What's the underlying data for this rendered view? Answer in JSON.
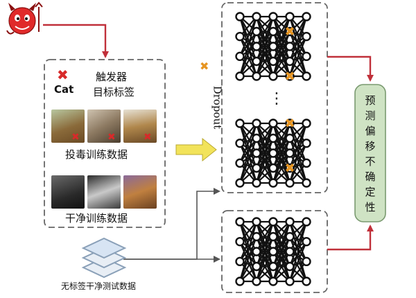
{
  "trigger": {
    "x_glyph": "✖",
    "label": "Cat",
    "title_line1": "触发器",
    "title_line2": "目标标签"
  },
  "poisoned_data_label": "投毒训练数据",
  "clean_data_label": "干净训练数据",
  "test_data_label": "无标签干净测试数据",
  "dropout": {
    "x_glyph": "✖",
    "label": "Dropout"
  },
  "ellipsis": "⋮",
  "output_label": "预测偏移不确定性",
  "colors": {
    "arrow_red": "#c0303a",
    "dropout_orange": "#e69522",
    "trigger_red": "#d82a2a",
    "output_box_fill": "#cfe3c4",
    "output_box_stroke": "#7a9a70",
    "yellow_arrow": "#f2e35a",
    "dashed_border": "#666666",
    "network": "#111111"
  },
  "icons": [
    "devil-icon",
    "stack-layers-icon",
    "cross-mark-icon"
  ]
}
